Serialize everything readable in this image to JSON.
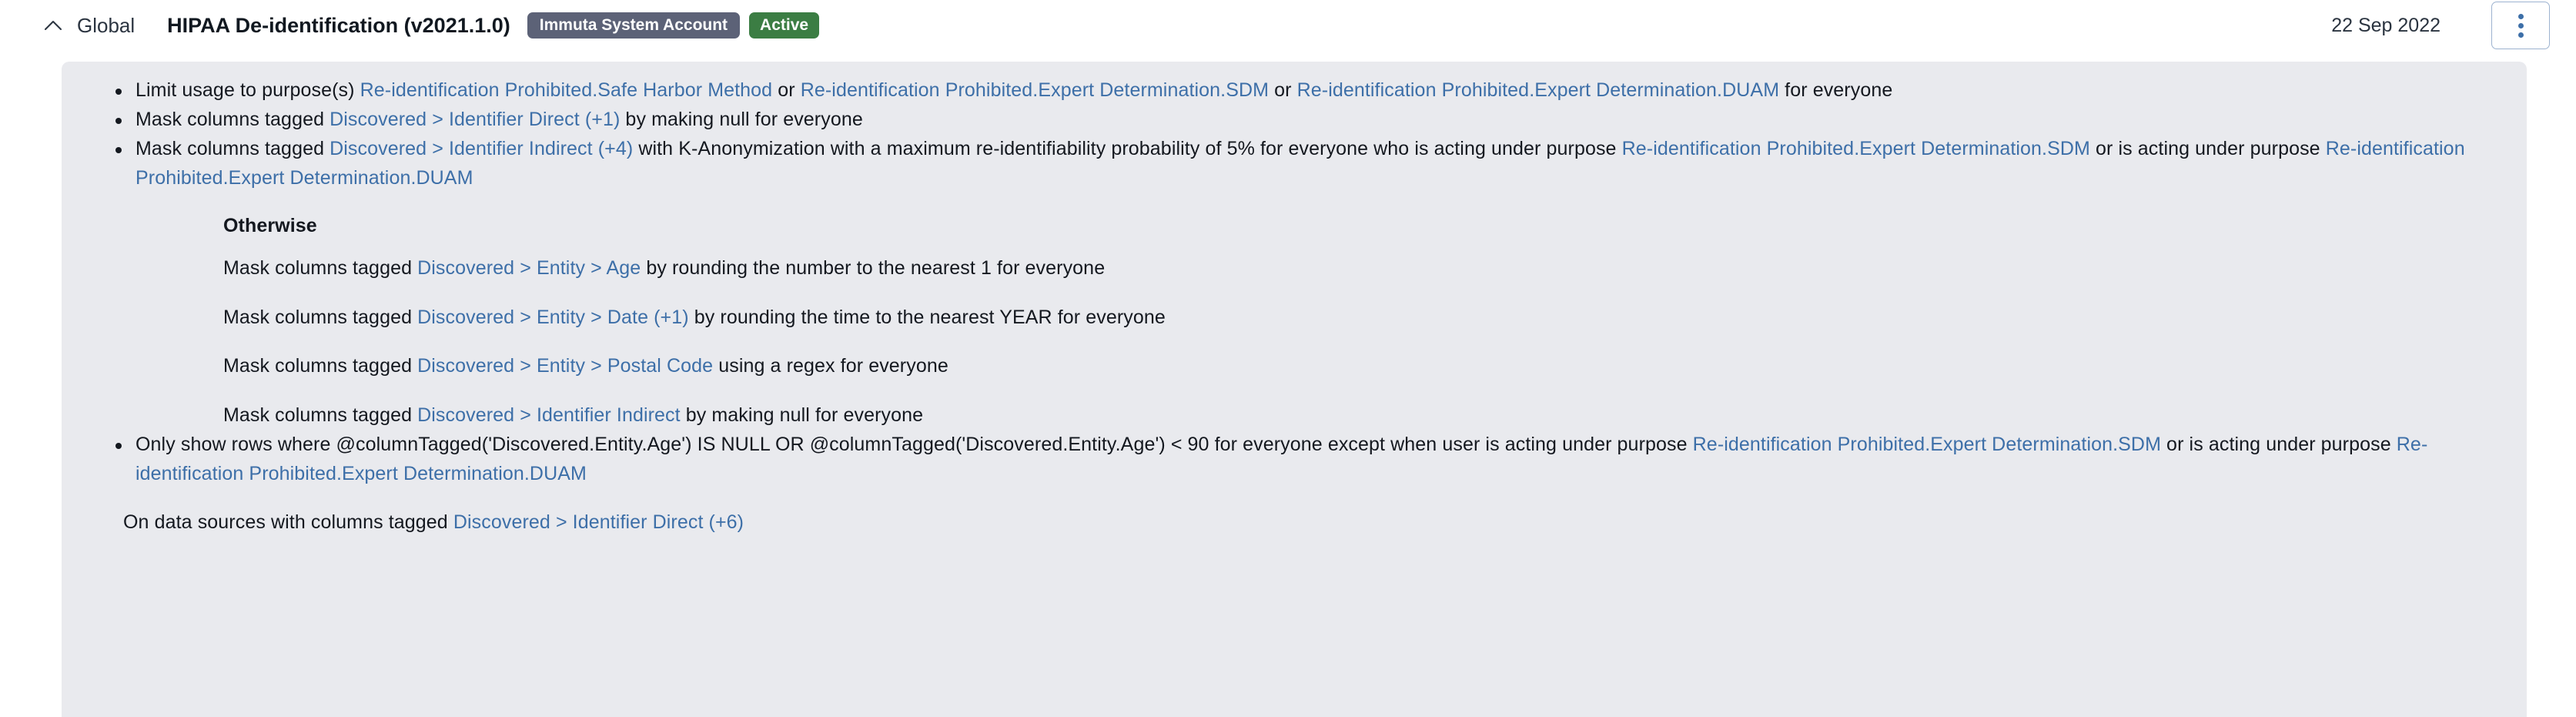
{
  "header": {
    "collapse_icon": "chevron-up-icon",
    "scope": "Global",
    "title": "HIPAA De-identification (v2021.1.0)",
    "owner_chip": "Immuta System Account",
    "status_chip": "Active",
    "date": "22 Sep 2022",
    "menu_icon": "kebab-menu-icon",
    "colors": {
      "owner_chip_bg": "#5c6277",
      "status_chip_bg": "#3b7d43",
      "link": "#3d6fa8",
      "card_bg": "#e9eaee",
      "menu_border": "#9db3d0"
    }
  },
  "rules": [
    {
      "id": "limit-usage-purposes",
      "segments": [
        {
          "text": "Limit usage to purpose(s) ",
          "link": false
        },
        {
          "text": "Re-identification Prohibited.Safe Harbor Method",
          "link": true
        },
        {
          "text": " or ",
          "link": false
        },
        {
          "text": "Re-identification Prohibited.Expert Determination.SDM",
          "link": true
        },
        {
          "text": " or ",
          "link": false
        },
        {
          "text": "Re-identification Prohibited.Expert Determination.DUAM",
          "link": true
        },
        {
          "text": " for everyone",
          "link": false
        }
      ]
    },
    {
      "id": "mask-identifier-direct",
      "segments": [
        {
          "text": "Mask columns tagged ",
          "link": false
        },
        {
          "text": "Discovered > Identifier Direct (+1)",
          "link": true
        },
        {
          "text": " by making null for everyone",
          "link": false
        }
      ]
    },
    {
      "id": "mask-identifier-indirect-k-anon",
      "segments": [
        {
          "text": "Mask columns tagged ",
          "link": false
        },
        {
          "text": "Discovered > Identifier Indirect (+4)",
          "link": true
        },
        {
          "text": " with K-Anonymization with a maximum re-identifiability probability of 5% for everyone who is acting under purpose ",
          "link": false
        },
        {
          "text": "Re-identification Prohibited.Expert Determination.SDM",
          "link": true
        },
        {
          "text": " or is acting under purpose ",
          "link": false
        },
        {
          "text": "Re-identification Prohibited.Expert Determination.DUAM",
          "link": true
        }
      ],
      "otherwise": {
        "title": "Otherwise",
        "items": [
          {
            "id": "otherwise-mask-age",
            "segments": [
              {
                "text": "Mask columns tagged ",
                "link": false
              },
              {
                "text": "Discovered > Entity > Age",
                "link": true
              },
              {
                "text": " by rounding the number to the nearest 1 for everyone",
                "link": false
              }
            ]
          },
          {
            "id": "otherwise-mask-date",
            "segments": [
              {
                "text": "Mask columns tagged ",
                "link": false
              },
              {
                "text": "Discovered > Entity > Date (+1)",
                "link": true
              },
              {
                "text": " by rounding the time to the nearest YEAR for everyone",
                "link": false
              }
            ]
          },
          {
            "id": "otherwise-mask-postal-code",
            "segments": [
              {
                "text": "Mask columns tagged ",
                "link": false
              },
              {
                "text": "Discovered > Entity > Postal Code",
                "link": true
              },
              {
                "text": " using a regex for everyone",
                "link": false
              }
            ]
          },
          {
            "id": "otherwise-mask-identifier-indirect",
            "segments": [
              {
                "text": "Mask columns tagged ",
                "link": false
              },
              {
                "text": "Discovered > Identifier Indirect",
                "link": true
              },
              {
                "text": " by making null for everyone",
                "link": false
              }
            ]
          }
        ]
      }
    },
    {
      "id": "only-show-rows-age",
      "segments": [
        {
          "text": "Only show rows where @columnTagged('Discovered.Entity.Age') IS NULL OR @columnTagged('Discovered.Entity.Age') < 90 for everyone except when user is acting under purpose ",
          "link": false
        },
        {
          "text": "Re-identification Prohibited.Expert Determination.SDM",
          "link": true
        },
        {
          "text": " or is acting under purpose ",
          "link": false
        },
        {
          "text": "Re-identification Prohibited.Expert Determination.DUAM",
          "link": true
        }
      ]
    }
  ],
  "footer": {
    "id": "data-sources-scope",
    "segments": [
      {
        "text": "On data sources with columns tagged ",
        "link": false
      },
      {
        "text": "Discovered > Identifier Direct (+6)",
        "link": true
      }
    ]
  }
}
